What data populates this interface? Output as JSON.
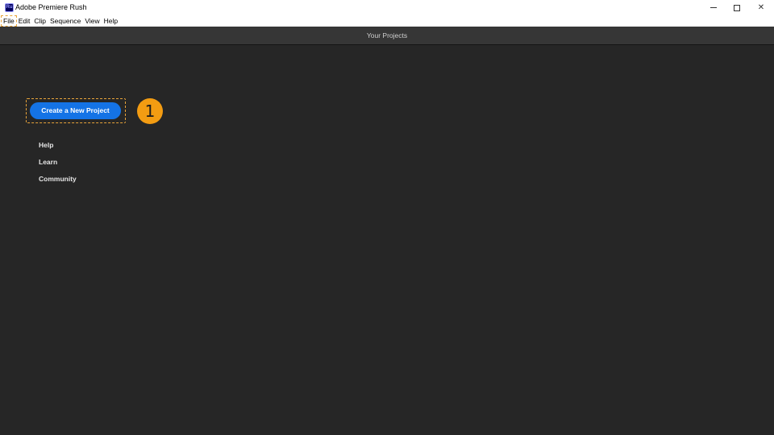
{
  "window": {
    "title": "Adobe Premiere Rush",
    "icon_text": "Ru",
    "icon": "premiere-rush-app-icon"
  },
  "menu": {
    "items": [
      "File",
      "Edit",
      "Clip",
      "Sequence",
      "View",
      "Help"
    ]
  },
  "header": {
    "title": "Your Projects"
  },
  "main": {
    "create_button_label": "Create a New Project",
    "links": [
      "Help",
      "Learn",
      "Community"
    ]
  },
  "annotation": {
    "step_number": "1",
    "highlight_color": "#e8a33a",
    "badge_color": "#f39c12"
  },
  "colors": {
    "accent": "#1473e6",
    "background": "#262626",
    "header": "#363636"
  }
}
